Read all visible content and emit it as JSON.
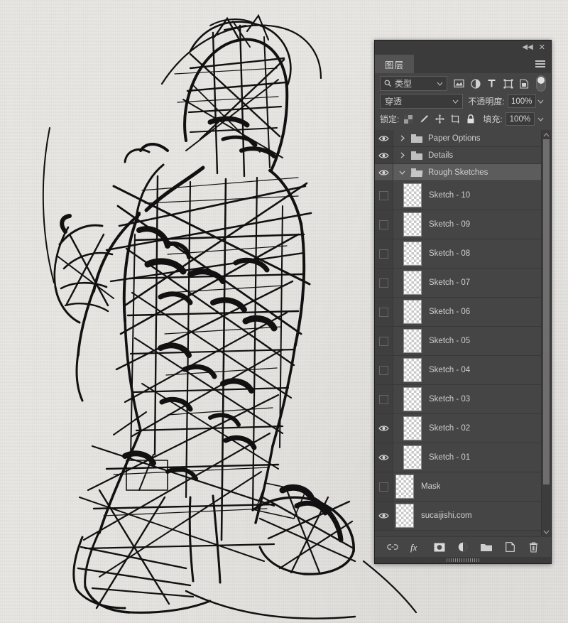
{
  "canvas": {
    "name": "sketch-artwork-canvas",
    "description": "rough ink sketch of a standing figure on textured paper",
    "paper_color": "#e9e8e5",
    "ink_color": "#111111"
  },
  "panel": {
    "title": "图层",
    "collapse_label": "◀◀",
    "close_label": "✕",
    "menu_label": "menu",
    "filter": {
      "type_label": "类型",
      "icons": [
        "pixel-filter-icon",
        "adjustment-filter-icon",
        "type-filter-icon",
        "shape-filter-icon",
        "smartobject-filter-icon"
      ],
      "toggle_label": "filter-enable-toggle"
    },
    "blend": {
      "mode": "穿透",
      "opacity_label": "不透明度:",
      "opacity_value": "100%"
    },
    "lock": {
      "label": "锁定:",
      "icons": [
        "lock-transparent-icon",
        "lock-image-icon",
        "lock-position-icon",
        "lock-artboard-icon",
        "lock-all-icon"
      ],
      "fill_label": "填充:",
      "fill_value": "100%"
    },
    "footer_buttons": [
      {
        "name": "link-layers-button",
        "glyph": "link"
      },
      {
        "name": "layer-style-fx-button",
        "glyph": "fx"
      },
      {
        "name": "add-layer-mask-button",
        "glyph": "mask"
      },
      {
        "name": "new-adjustment-layer-button",
        "glyph": "adjust"
      },
      {
        "name": "new-group-button",
        "glyph": "folder"
      },
      {
        "name": "new-layer-button",
        "glyph": "newlayer"
      },
      {
        "name": "delete-layer-button",
        "glyph": "trash"
      }
    ],
    "scrollbar": {
      "up": "▲",
      "down": "▼"
    }
  },
  "layers": [
    {
      "name": "Paper Options",
      "kind": "group",
      "visible": true,
      "expanded": false,
      "selected": false,
      "thumb": "none"
    },
    {
      "name": "Details",
      "kind": "group",
      "visible": true,
      "expanded": false,
      "selected": false,
      "thumb": "none"
    },
    {
      "name": "Rough Sketches",
      "kind": "group",
      "visible": true,
      "expanded": true,
      "selected": true,
      "thumb": "none"
    },
    {
      "name": "Sketch - 10",
      "kind": "layer",
      "visible": false,
      "indent": true,
      "selected": false,
      "thumb": "figure-black"
    },
    {
      "name": "Sketch - 09",
      "kind": "layer",
      "visible": false,
      "indent": true,
      "selected": false,
      "thumb": "figure-black"
    },
    {
      "name": "Sketch - 08",
      "kind": "layer",
      "visible": false,
      "indent": true,
      "selected": false,
      "thumb": "figure-black"
    },
    {
      "name": "Sketch - 07",
      "kind": "layer",
      "visible": false,
      "indent": true,
      "selected": false,
      "thumb": "figure-black"
    },
    {
      "name": "Sketch - 06",
      "kind": "layer",
      "visible": false,
      "indent": true,
      "selected": false,
      "thumb": "figure-black"
    },
    {
      "name": "Sketch - 05",
      "kind": "layer",
      "visible": false,
      "indent": true,
      "selected": false,
      "thumb": "figure-black"
    },
    {
      "name": "Sketch - 04",
      "kind": "layer",
      "visible": false,
      "indent": true,
      "selected": false,
      "thumb": "figure-black"
    },
    {
      "name": "Sketch - 03",
      "kind": "layer",
      "visible": false,
      "indent": true,
      "selected": false,
      "thumb": "figure-black"
    },
    {
      "name": "Sketch - 02",
      "kind": "layer",
      "visible": true,
      "indent": true,
      "selected": false,
      "thumb": "figure-black"
    },
    {
      "name": "Sketch - 01",
      "kind": "layer",
      "visible": true,
      "indent": true,
      "selected": false,
      "thumb": "figure-black"
    },
    {
      "name": "Mask",
      "kind": "layer",
      "visible": false,
      "indent": false,
      "selected": false,
      "thumb": "figure-red"
    },
    {
      "name": "sucaijishi.com",
      "kind": "layer",
      "visible": true,
      "indent": false,
      "selected": false,
      "thumb": "empty"
    }
  ]
}
